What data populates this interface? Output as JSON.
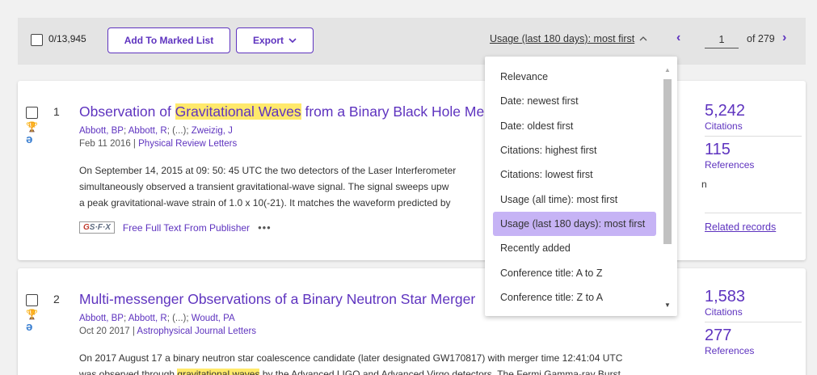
{
  "toolbar": {
    "selected_count": "0/13,945",
    "add_to_marked_list": "Add To Marked List",
    "export_label": "Export",
    "sort_label": "Usage (last 180 days): most first",
    "page_current": "1",
    "page_of": "of 279"
  },
  "sort_options": [
    "Relevance",
    "Date: newest first",
    "Date: oldest first",
    "Citations: highest first",
    "Citations: lowest first",
    "Usage (all time): most first",
    "Usage (last 180 days): most first",
    "Recently added",
    "Conference title: A to Z",
    "Conference title: Z to A"
  ],
  "selected_sort_index": 6,
  "records": [
    {
      "number": "1",
      "title_prefix": "Observation of ",
      "title_highlight": "Gravitational Waves",
      "title_suffix": " from a Binary Black Hole Merge",
      "authors": [
        "Abbott, BP",
        "Abbott, R",
        "(...)",
        "Zweizig, J"
      ],
      "date": "Feb 11 2016",
      "journal": "Physical Review Letters",
      "abstract_lines": [
        "On September 14, 2015 at 09: 50: 45 UTC the two detectors of the Laser Interferometer",
        "simultaneously observed a transient gravitational-wave signal. The signal sweeps upw",
        "a peak gravitational-wave strain of 1.0 x 10(-21). It matches the waveform predicted by"
      ],
      "abstract_trailing_char": "n",
      "sfx_label": "S·F·X",
      "full_text_link": "Free Full Text From Publisher",
      "more_label": "•••",
      "citations": "5,242",
      "citations_label": "Citations",
      "references": "115",
      "references_label": "References",
      "related_records": "Related records"
    },
    {
      "number": "2",
      "title": "Multi-messenger Observations of a Binary Neutron Star Merger",
      "authors": [
        "Abbott, BP",
        "Abbott, R",
        "(...)",
        "Woudt, PA"
      ],
      "date": "Oct 20 2017",
      "journal": "Astrophysical Journal Letters",
      "abstract_line1": "On 2017 August 17 a binary neutron star coalescence candidate (later designated GW170817) with merger time 12:41:04 UTC",
      "abstract_line2_prefix": "was observed through ",
      "abstract_line2_highlight": "gravitational waves",
      "abstract_line2_suffix": " by the Advanced LIGO and Advanced Virgo detectors. The Fermi Gamma-ray Burst",
      "citations": "1,583",
      "citations_label": "Citations",
      "references": "277",
      "references_label": "References"
    }
  ],
  "colors": {
    "accent": "#5e33bf",
    "highlight": "#ffe96b",
    "selected_option": "#c6b3f5",
    "toolbar_bg": "#e4e4e4"
  }
}
